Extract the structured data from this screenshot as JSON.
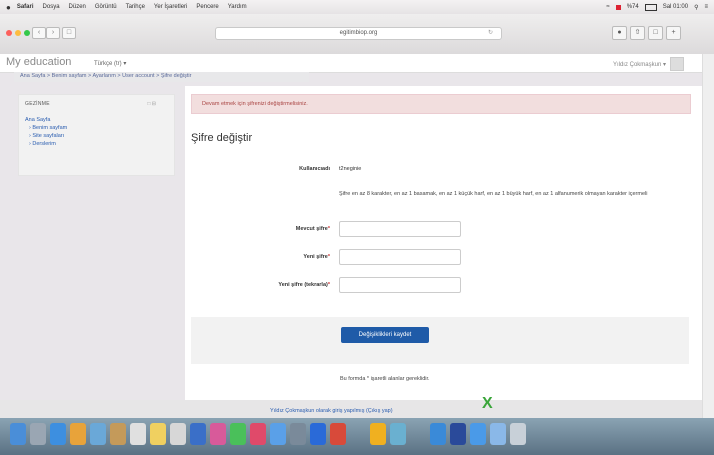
{
  "menubar": {
    "apple": "",
    "items": [
      "Safari",
      "Dosya",
      "Düzen",
      "Görüntü",
      "Tarihçe",
      "Yer İşaretleri",
      "Pencere",
      "Yardım"
    ],
    "status": [
      "%74",
      "Sal 01:00"
    ]
  },
  "browser": {
    "address": "egitimbiop.org",
    "reload_icon": "reload-icon"
  },
  "site": {
    "brand": "My education",
    "menu": "Türkçe (tr) ▾",
    "user": "Yıldız Çokmaşkun ▾"
  },
  "breadcrumb": "Ana Sayfa > Benim sayfam > Ayarlarım > User account > Şifre değiştir",
  "sidebar": {
    "heading": "GEZİNME",
    "control": "□ ⊟",
    "items": [
      "Ana Sayfa",
      "› Benim sayfam",
      "› Site sayfaları",
      "› Derslerim"
    ]
  },
  "main": {
    "alert": "Devam etmek için şifrenizi değiştirmelisiniz.",
    "heading": "Şifre değiştir",
    "username_label": "Kullanıcıadı",
    "username_value": "t2neginie",
    "policy": "Şifre en az 8 karakter, en az 1 basamak, en az 1 küçük harf, en az 1 büyük harf, en az 1 alfanumerik olmayan karakter içermeli",
    "current_label": "Mevcut şifre",
    "new_label": "Yeni şifre",
    "new_again_label": "Yeni şifre (tekrarla)",
    "required_mark": "*",
    "save_button": "Değişiklikleri kaydet",
    "footnote": "Bu formda * işaretli alanlar gereklidir."
  },
  "footer": {
    "logged_in": "Yıldız Çokmaşkun olarak giriş yapılmış (Çıkış yap)",
    "x_mark": "X"
  },
  "colors": {
    "accent": "#1f5ba8",
    "alert_bg": "#f2dede",
    "alert_text": "#a94442",
    "link": "#2a5db0"
  }
}
